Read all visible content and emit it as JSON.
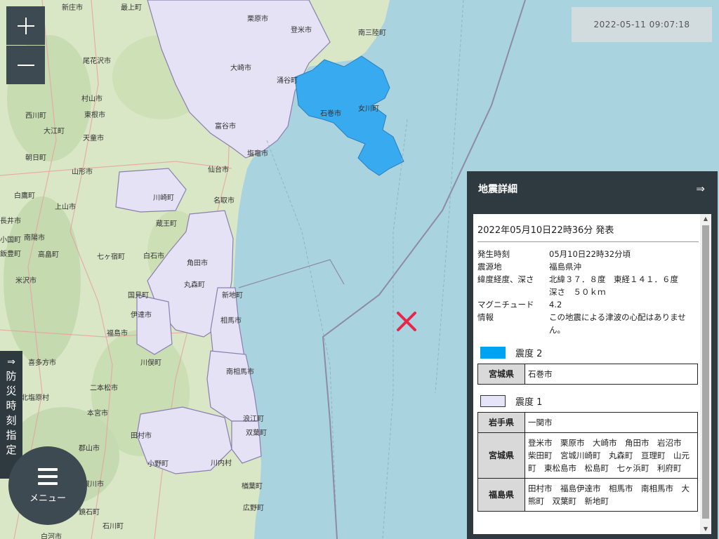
{
  "map": {
    "cities": [
      {
        "id": "shinjo",
        "name": "新庄市"
      },
      {
        "id": "mogami",
        "name": "最上町"
      },
      {
        "id": "kurihara",
        "name": "栗原市"
      },
      {
        "id": "tome",
        "name": "登米市"
      },
      {
        "id": "minamisanriku",
        "name": "南三陸町"
      },
      {
        "id": "obanazawa",
        "name": "尾花沢市"
      },
      {
        "id": "osaki",
        "name": "大崎市"
      },
      {
        "id": "wakuya",
        "name": "涌谷町"
      },
      {
        "id": "murayama",
        "name": "村山市"
      },
      {
        "id": "higashine",
        "name": "東根市"
      },
      {
        "id": "nishikawa",
        "name": "西川町"
      },
      {
        "id": "ishinomaki",
        "name": "石巻市"
      },
      {
        "id": "onagawa",
        "name": "女川町"
      },
      {
        "id": "oe",
        "name": "大江町"
      },
      {
        "id": "tendo",
        "name": "天童市"
      },
      {
        "id": "tomiya",
        "name": "富谷市"
      },
      {
        "id": "asahi",
        "name": "朝日町"
      },
      {
        "id": "shiogama",
        "name": "塩竈市"
      },
      {
        "id": "yamagata",
        "name": "山形市"
      },
      {
        "id": "sendai",
        "name": "仙台市"
      },
      {
        "id": "shirataka",
        "name": "白鷹町"
      },
      {
        "id": "kawasaki",
        "name": "川崎町"
      },
      {
        "id": "kaminoyama",
        "name": "上山市"
      },
      {
        "id": "natori",
        "name": "名取市"
      },
      {
        "id": "nagai",
        "name": "長井市"
      },
      {
        "id": "zao",
        "name": "蔵王町"
      },
      {
        "id": "nanyo",
        "name": "南陽市"
      },
      {
        "id": "shiroishi",
        "name": "白石市"
      },
      {
        "id": "takahata",
        "name": "高畠町"
      },
      {
        "id": "shichikashuku",
        "name": "七ヶ宿町"
      },
      {
        "id": "kakuda",
        "name": "角田市"
      },
      {
        "id": "yonezawa",
        "name": "米沢市"
      },
      {
        "id": "marumori",
        "name": "丸森町"
      },
      {
        "id": "kunimi",
        "name": "国見町"
      },
      {
        "id": "shinchi",
        "name": "新地町"
      },
      {
        "id": "date",
        "name": "伊達市"
      },
      {
        "id": "soma",
        "name": "相馬市"
      },
      {
        "id": "fukushima",
        "name": "福島市"
      },
      {
        "id": "kawamata",
        "name": "川俣町"
      },
      {
        "id": "minamisoma",
        "name": "南相馬市"
      },
      {
        "id": "nihonmatsu",
        "name": "二本松市"
      },
      {
        "id": "motomiya",
        "name": "本宮市"
      },
      {
        "id": "namie",
        "name": "浪江町"
      },
      {
        "id": "tamura",
        "name": "田村市"
      },
      {
        "id": "futaba",
        "name": "双葉町"
      },
      {
        "id": "koriyama",
        "name": "郡山市"
      },
      {
        "id": "ono",
        "name": "小野町"
      },
      {
        "id": "kawauchi",
        "name": "川内村"
      },
      {
        "id": "naraha",
        "name": "楢葉町"
      },
      {
        "id": "sukagawa",
        "name": "須賀川市"
      },
      {
        "id": "ishikawa",
        "name": "石川町"
      },
      {
        "id": "hirono",
        "name": "広野町"
      },
      {
        "id": "sakata_iide",
        "name": "飯豊町"
      },
      {
        "id": "oguni",
        "name": "小国町"
      },
      {
        "id": "shirakawa_edge",
        "name": "白河市"
      },
      {
        "id": "kitashiobara",
        "name": "北塩原村"
      },
      {
        "id": "takasaka",
        "name": "高畠町"
      },
      {
        "id": "ichinoseki",
        "name": "一関市"
      },
      {
        "id": "kitakata_edge",
        "name": "喜多方市"
      },
      {
        "id": "kagamiishi",
        "name": "鏡石町"
      }
    ],
    "epicenter_marker": "epicenter-x-icon",
    "colors": {
      "sea": "#a9d3df",
      "land": "#dbe8c8",
      "intensity2": "#38aaf0",
      "intensity1": "#e4e2f4",
      "boundary": "#8a7fb0",
      "epicenter": "#e8264c"
    }
  },
  "controls": {
    "zoom_in_icon": "plus-icon",
    "zoom_out_icon": "minus-icon"
  },
  "timestamp": "2022-05-11 09:07:18",
  "side_tab": {
    "arrow": "⇒",
    "text": "防災時刻指定"
  },
  "menu": {
    "label": "メニュー",
    "icon": "hamburger-icon"
  },
  "panel": {
    "title": "地震詳細",
    "close_arrow": "⇒",
    "announcement": "2022年05月10日22時36分 発表",
    "info": [
      {
        "key": "発生時刻",
        "value": "05月10日22時32分頃"
      },
      {
        "key": "震源地",
        "value": "福島県沖"
      },
      {
        "key": "緯度経度、深さ",
        "value": "北緯３７．８度　東経１４１．６度"
      },
      {
        "key": "",
        "value": "深さ　５０ｋｍ"
      },
      {
        "key": "マグニチュード",
        "value": "4.2"
      },
      {
        "key": "情報",
        "value": "この地震による津波の心配はありません。"
      }
    ],
    "intensity2": {
      "label": "震度 2",
      "color": "#00a2f2",
      "rows": [
        {
          "pref": "宮城県",
          "areas": "石巻市"
        }
      ]
    },
    "intensity1": {
      "label": "震度 1",
      "color": "#e6e4f8",
      "rows": [
        {
          "pref": "岩手県",
          "areas": "一関市"
        },
        {
          "pref": "宮城県",
          "areas": "登米市　栗原市　大崎市　角田市　岩沼市　柴田町　宮城川崎町　丸森町　亘理町　山元町　東松島市　松島町　七ヶ浜町　利府町"
        },
        {
          "pref": "福島県",
          "areas": "田村市　福島伊達市　相馬市　南相馬市　大熊町　双葉町　新地町"
        }
      ]
    }
  }
}
